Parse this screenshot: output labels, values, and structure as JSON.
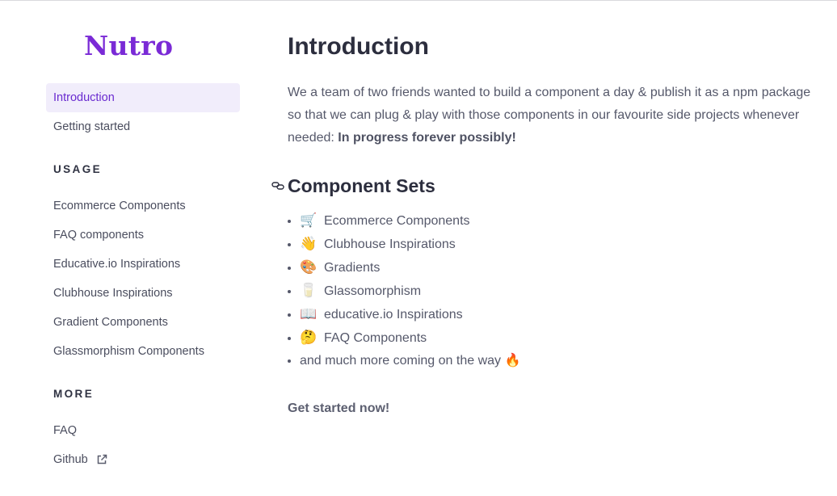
{
  "brand": {
    "name": "Nutro"
  },
  "sidebar": {
    "top_items": [
      {
        "label": "Introduction",
        "active": true
      },
      {
        "label": "Getting started",
        "active": false
      }
    ],
    "usage": {
      "title": "USAGE",
      "items": [
        "Ecommerce Components",
        "FAQ components",
        "Educative.io Inspirations",
        "Clubhouse Inspirations",
        "Gradient Components",
        "Glassmorphism Components"
      ]
    },
    "more": {
      "title": "MORE",
      "items": [
        "FAQ",
        "Github"
      ]
    }
  },
  "main": {
    "title": "Introduction",
    "intro_text": "We a team of two friends wanted to build a component a day & publish it as a npm package so that we can plug & play with those components in our favourite side projects whenever needed: ",
    "intro_bold": "In progress forever possibly!",
    "sets_title": "Component Sets",
    "sets": [
      {
        "emoji": "🛒",
        "label": "Ecommerce Components"
      },
      {
        "emoji": "👋",
        "label": "Clubhouse Inspirations"
      },
      {
        "emoji": "🎨",
        "label": "Gradients"
      },
      {
        "emoji": "🥛",
        "label": "Glassomorphism"
      },
      {
        "emoji": "📖",
        "label": "educative.io Inspirations"
      },
      {
        "emoji": "🤔",
        "label": "FAQ Components"
      }
    ],
    "more_coming": "and much more coming on the way",
    "more_coming_emoji": "🔥",
    "cta": "Get started now!"
  },
  "colors": {
    "accent": "#7a2ad6",
    "active_bg": "#f1edfb"
  }
}
